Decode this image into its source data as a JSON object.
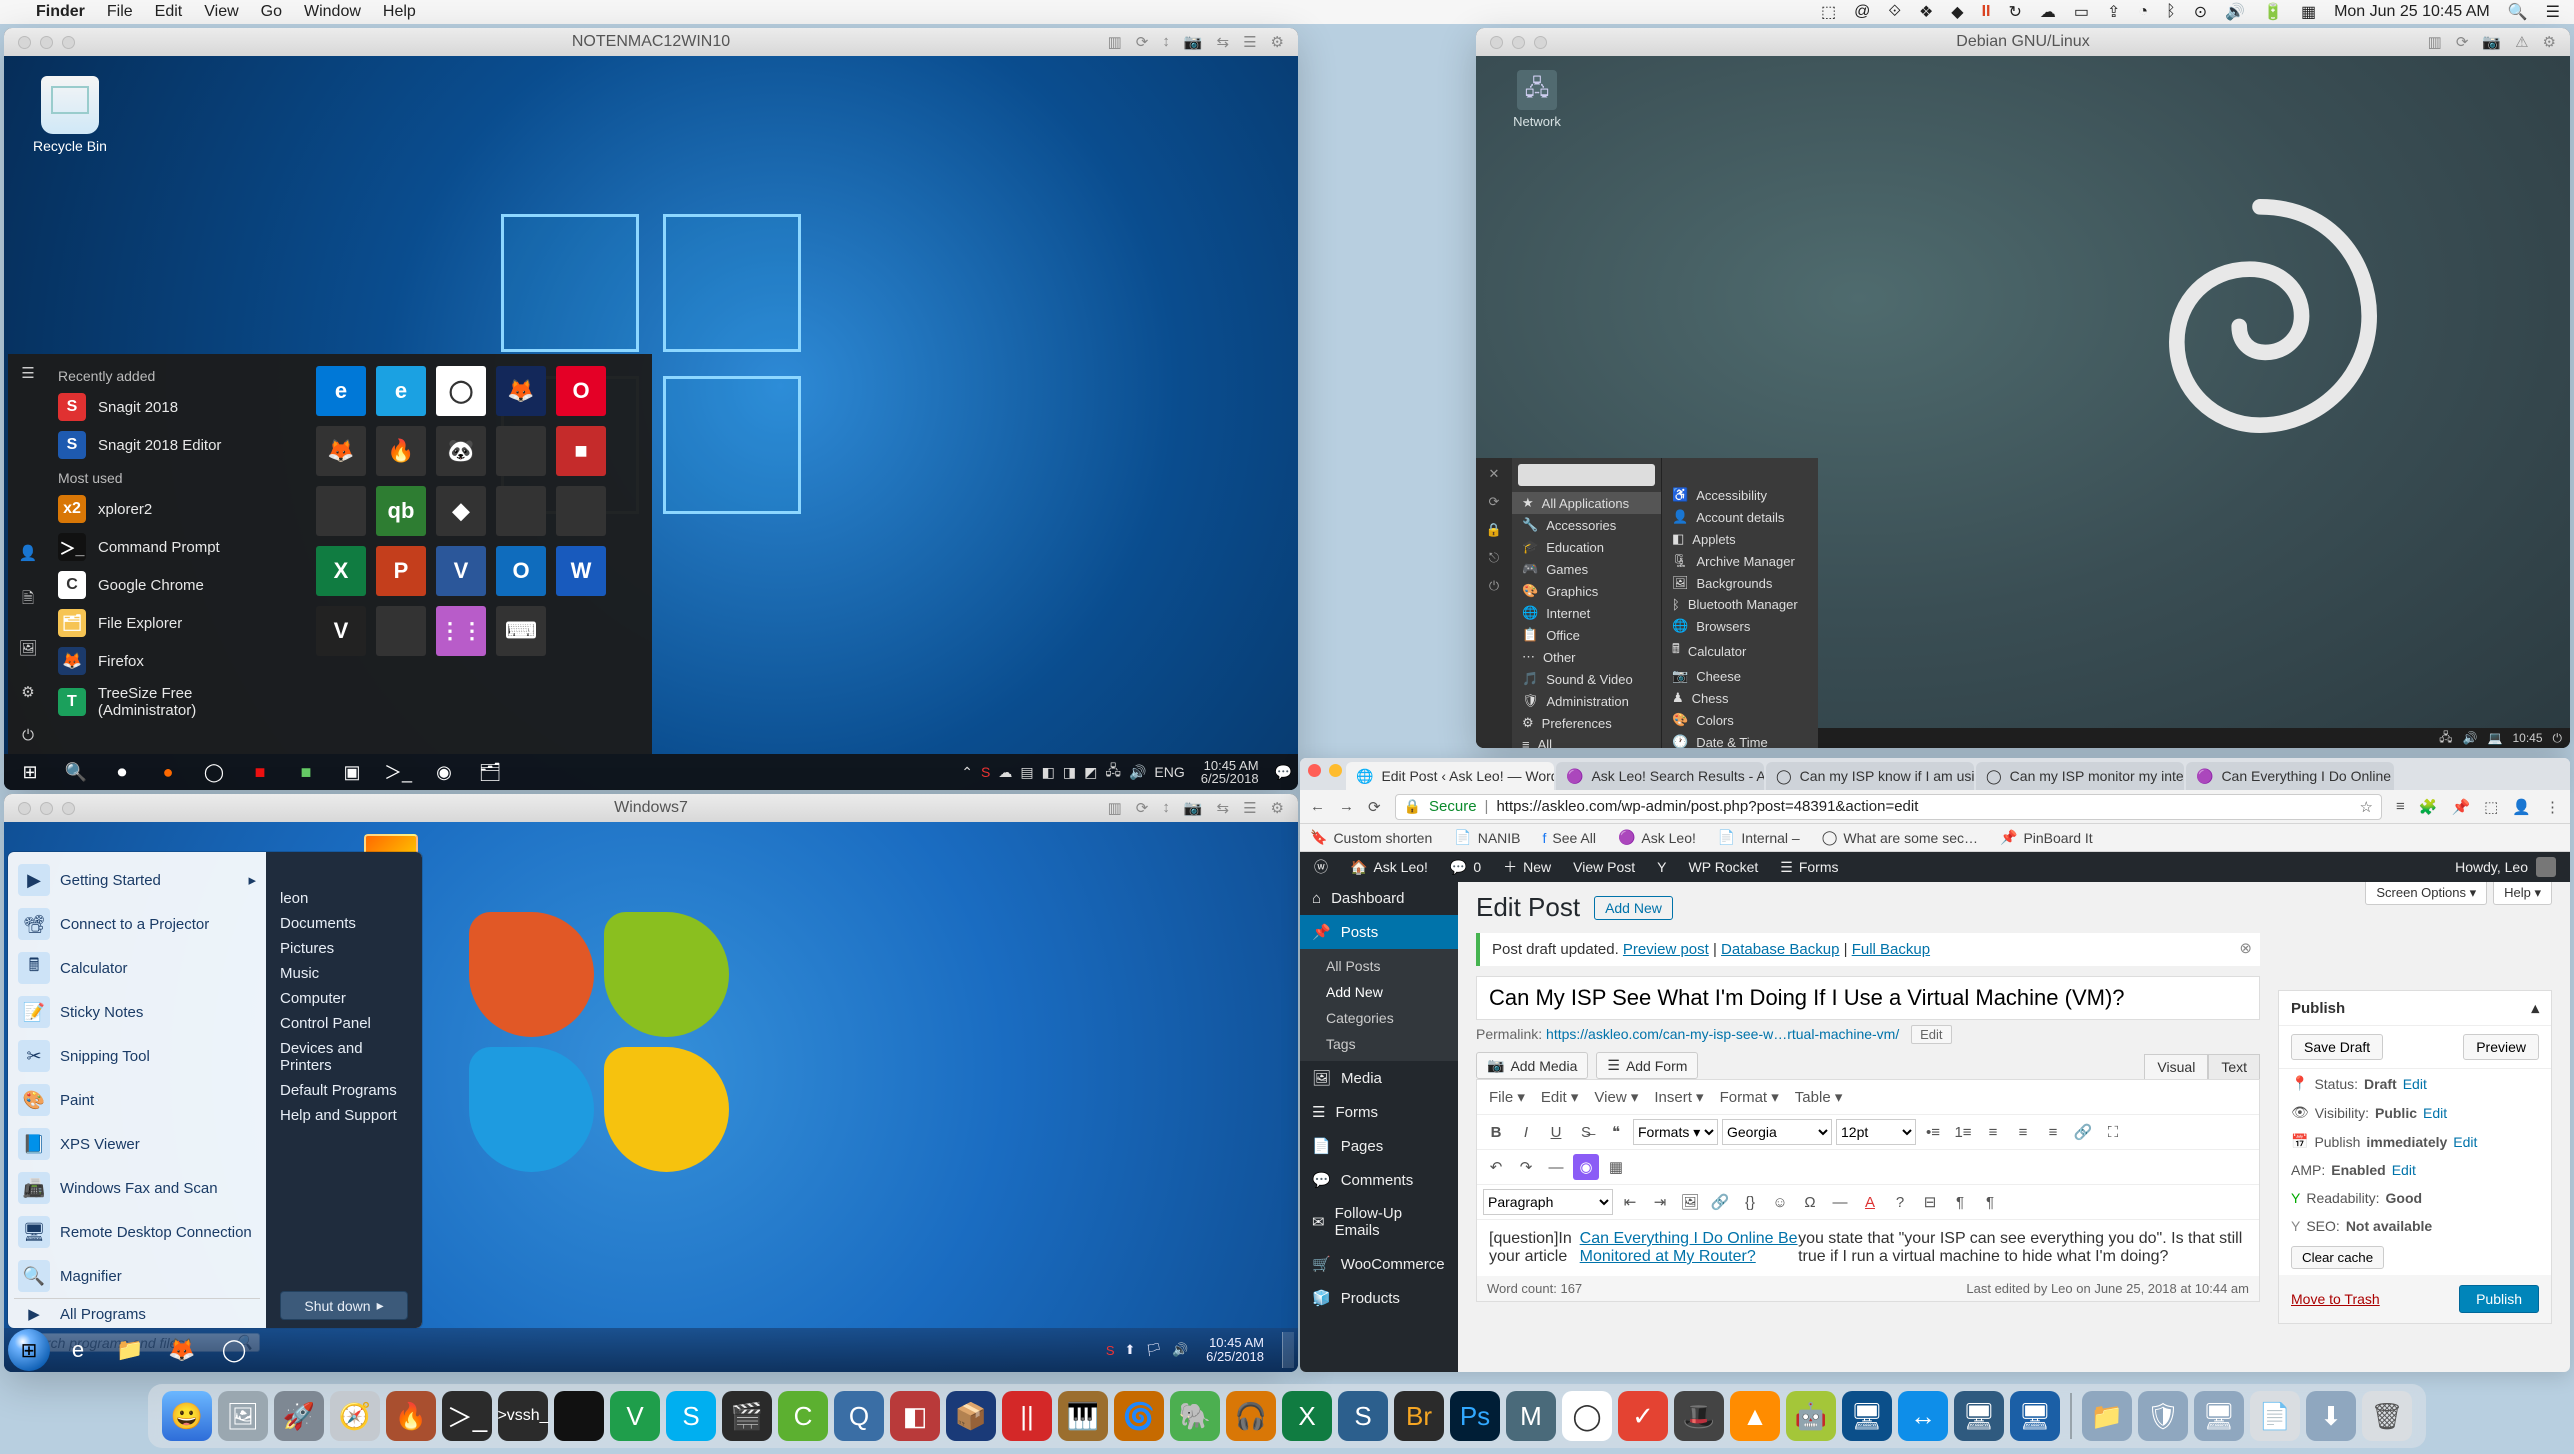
{
  "mac_menu": {
    "app": "Finder",
    "items": [
      "File",
      "Edit",
      "View",
      "Go",
      "Window",
      "Help"
    ],
    "clock": "Mon Jun 25  10:45 AM",
    "status_icons": [
      "dropbox",
      "at",
      "anchor",
      "gear",
      "diamond",
      "pause",
      "sync",
      "cloud",
      "display",
      "share",
      "clock",
      "bluetooth",
      "wifi",
      "battery",
      "volume",
      "input",
      "controlcenter"
    ]
  },
  "win10": {
    "title": "NOTENMAC12WIN10",
    "recycle": "Recycle Bin",
    "start": {
      "sections": {
        "recent_hdr": "Recently added",
        "recent": [
          "Snagit 2018",
          "Snagit 2018 Editor"
        ],
        "most_hdr": "Most used",
        "most": [
          "xplorer2",
          "Command Prompt",
          "Google Chrome",
          "File Explorer",
          "Firefox",
          "TreeSize Free (Administrator)"
        ]
      },
      "tiles": [
        "e",
        "e",
        "C",
        "F",
        "O",
        "🦊",
        "🔥",
        "🐼",
        "",
        "■",
        "",
        "",
        "X",
        "P",
        "V",
        "O",
        "W",
        "V",
        "",
        "⋮⋮",
        "⌨"
      ]
    },
    "taskbar": {
      "pins": [
        "⊞",
        "🔍",
        "⏺",
        "●",
        "C",
        "■",
        "■",
        "■",
        "▣",
        "▭"
      ],
      "tray": [
        "⌃",
        "S",
        "☁",
        "▤",
        "🔈",
        "🔋",
        "🌐",
        "⚙",
        "🖧",
        "📶",
        "🔊"
      ],
      "lang": "ENG",
      "time": "10:45 AM",
      "date": "6/25/2018"
    }
  },
  "debian": {
    "title": "Debian GNU/Linux",
    "desktop_icon": "Network",
    "launcher": {
      "search_ph": "",
      "all_apps": "All Applications",
      "categories": [
        "Accessories",
        "Education",
        "Games",
        "Graphics",
        "Internet",
        "Office",
        "Other",
        "Sound & Video",
        "Administration",
        "Preferences",
        "All"
      ],
      "apps": [
        "Accessibility",
        "Account details",
        "Applets",
        "Archive Manager",
        "Backgrounds",
        "Bluetooth Manager",
        "Browsers",
        "Calculator",
        "Cheese",
        "Chess",
        "Colors",
        "Date & Time"
      ]
    },
    "clock": "10:45"
  },
  "win7": {
    "title": "Windows7",
    "start": {
      "left": [
        "Getting Started",
        "Connect to a Projector",
        "Calculator",
        "Sticky Notes",
        "Snipping Tool",
        "Paint",
        "XPS Viewer",
        "Windows Fax and Scan",
        "Remote Desktop Connection",
        "Magnifier"
      ],
      "all_programs": "All Programs",
      "search_ph": "Search programs and files",
      "right": [
        "leon",
        "Documents",
        "Pictures",
        "Music",
        "Computer",
        "Control Panel",
        "Devices and Printers",
        "Default Programs",
        "Help and Support"
      ],
      "shutdown": "Shut down"
    },
    "taskbar": {
      "pins": [
        "🌐",
        "📁",
        "🦊",
        "C"
      ],
      "tray": [
        "S",
        "⬆",
        "🔊",
        "🏳"
      ],
      "time": "10:45 AM",
      "date": "6/25/2018"
    }
  },
  "wp": {
    "tabs": [
      {
        "label": "Edit Post ‹ Ask Leo! — WordP",
        "active": true
      },
      {
        "label": "Ask Leo! Search Results - Ask"
      },
      {
        "label": "Can my ISP know if I am using"
      },
      {
        "label": "Can my ISP monitor my inter"
      },
      {
        "label": "Can Everything I Do Online B"
      }
    ],
    "url_secure": "Secure",
    "url": "https://askleo.com/wp-admin/post.php?post=48391&action=edit",
    "bookmarks": [
      "Custom shorten",
      "NANIB",
      "See All",
      "Ask Leo!",
      "Internal –",
      "What are some sec…",
      "PinBoard It"
    ],
    "adminbar": {
      "site": "Ask Leo!",
      "comments": "0",
      "new": "New",
      "viewpost": "View Post",
      "rocket": "WP Rocket",
      "forms": "Forms",
      "howdy": "Howdy, Leo"
    },
    "sidebar": {
      "items": [
        {
          "icon": "⌂",
          "label": "Dashboard"
        },
        {
          "icon": "📌",
          "label": "Posts",
          "active": true,
          "sub": [
            "All Posts",
            "Add New",
            "Categories",
            "Tags"
          ],
          "sub_active": 1
        },
        {
          "icon": "🖼",
          "label": "Media"
        },
        {
          "icon": "☰",
          "label": "Forms"
        },
        {
          "icon": "📄",
          "label": "Pages"
        },
        {
          "icon": "💬",
          "label": "Comments"
        },
        {
          "icon": "✉",
          "label": "Follow-Up Emails"
        },
        {
          "icon": "🛒",
          "label": "WooCommerce"
        },
        {
          "icon": "🧊",
          "label": "Products"
        }
      ]
    },
    "screen_options": "Screen Options ▾",
    "help": "Help ▾",
    "page_title": "Edit Post",
    "add_new": "Add New",
    "notice_pre": "Post draft updated. ",
    "notice_links": [
      "Preview post",
      "Database Backup",
      "Full Backup"
    ],
    "post_title": "Can My ISP See What I'm Doing If I Use a Virtual Machine (VM)?",
    "permalink_label": "Permalink:",
    "permalink_url": "https://askleo.com/can-my-isp-see-w…rtual-machine-vm/",
    "permalink_edit": "Edit",
    "add_media": "Add Media",
    "add_form": "Add Form",
    "visual": "Visual",
    "text": "Text",
    "toolbar": {
      "file": "File ▾",
      "edit": "Edit ▾",
      "view": "View ▾",
      "insert": "Insert ▾",
      "format": "Format ▾",
      "table": "Table ▾",
      "formats": "Formats ▾",
      "font": "Georgia",
      "size": "12pt",
      "para": "Paragraph"
    },
    "body_pre": "[question]In your article ",
    "body_link": "Can Everything I Do Online Be Monitored at My Router?",
    "body_post": " you state that \"your ISP can see everything you do\". Is that still true if I run a virtual machine to hide what I'm doing?",
    "wordcount_label": "Word count: ",
    "wordcount": "167",
    "lastedit": "Last edited by Leo on June 25, 2018 at 10:44 am",
    "publish": {
      "title": "Publish",
      "save_draft": "Save Draft",
      "preview": "Preview",
      "status_lbl": "Status:",
      "status_val": "Draft",
      "status_edit": "Edit",
      "vis_lbl": "Visibility:",
      "vis_val": "Public",
      "vis_edit": "Edit",
      "sched_lbl": "Publish",
      "sched_val": "immediately",
      "sched_edit": "Edit",
      "amp_lbl": "AMP:",
      "amp_val": "Enabled",
      "amp_edit": "Edit",
      "read_lbl": "Readability:",
      "read_val": "Good",
      "seo_lbl": "SEO:",
      "seo_val": "Not available",
      "clear_cache": "Clear cache",
      "trash": "Move to Trash",
      "publish_btn": "Publish"
    }
  },
  "dock": [
    "Finder",
    "Preview",
    "Launchpad",
    "Safari",
    "Flame",
    "Terminal",
    "vssh",
    "Black",
    "Vim",
    "Skype",
    "FCP",
    "Camtasia",
    "QT",
    "Red",
    "VBox",
    "Parallels",
    "Piezo",
    "Hazel",
    "Evernote",
    "Audacity",
    "Excel",
    "Snagit",
    "Bridge",
    "Photoshop",
    "M",
    "Chrome",
    "Todoist",
    "Discord",
    "VLC",
    "Android",
    "VM1",
    "TeamViewer",
    "VM2",
    "VM3",
    "Sep",
    "Box",
    "Shield",
    "Desktop",
    "Doc",
    "Downloads",
    "Trash"
  ]
}
